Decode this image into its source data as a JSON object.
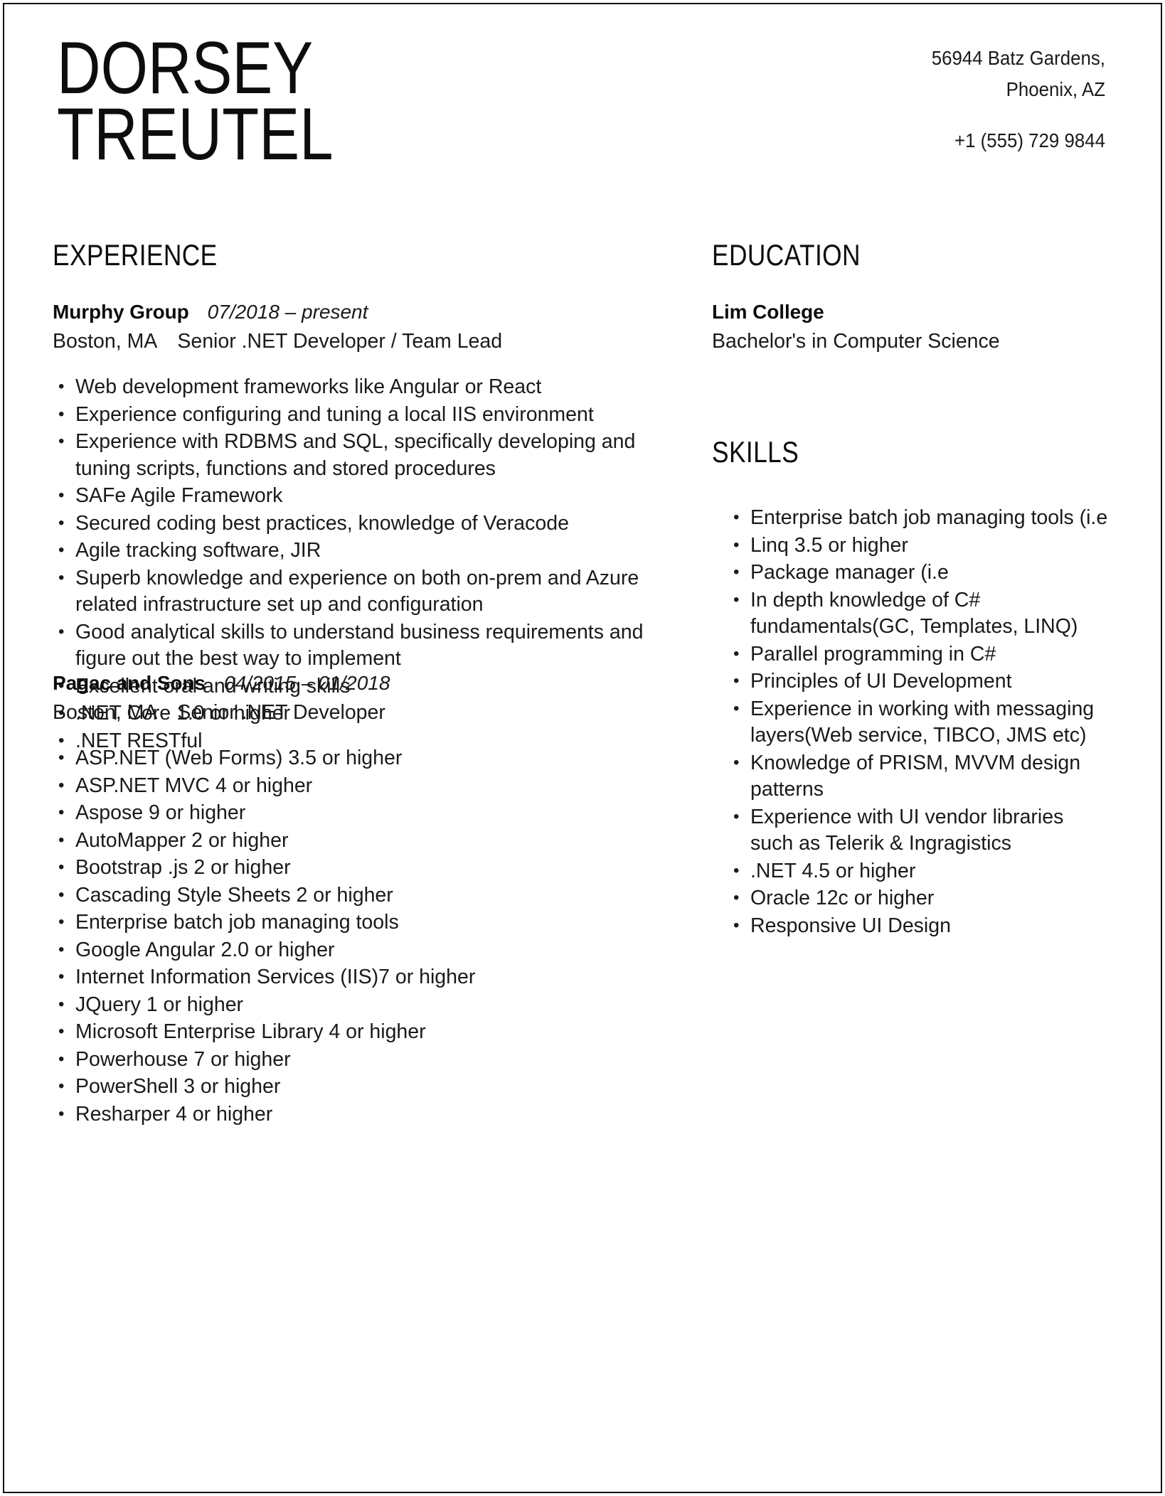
{
  "document": {
    "type": "resume"
  },
  "header": {
    "name_line_1": "DORSEY",
    "name_line_2": "TREUTEL",
    "address_line_1": "56944 Batz Gardens,",
    "address_line_2": "Phoenix, AZ",
    "phone": "+1 (555) 729 9844"
  },
  "experience": {
    "title": "EXPERIENCE",
    "entries": [
      {
        "organization": "Murphy Group",
        "dates": "07/2018 – present",
        "location": "Boston, MA",
        "role": "Senior .NET Developer / Team Lead",
        "bullets": [
          "Web development frameworks like Angular or React",
          "Experience configuring and tuning a local IIS environment",
          "Experience with RDBMS and SQL, specifically developing and tuning scripts, functions and stored procedures",
          "SAFe Agile Framework",
          "Secured coding best practices, knowledge of Veracode",
          "Agile tracking software, JIR",
          "Superb knowledge and experience on both on-prem and Azure related infrastructure set up and configuration",
          "Good analytical skills to understand business requirements and figure out the best way to implement",
          "Excellent oral and writing skills",
          ".NET Core 1.0 or higher",
          ".NET RESTful"
        ]
      },
      {
        "organization": "Pagac and Sons",
        "dates": "04/2015 – 01/2018",
        "location": "Boston, MA",
        "role": "Senior .NET Developer",
        "bullets": [
          "ASP.NET (Web Forms) 3.5 or higher",
          "ASP.NET MVC 4 or higher",
          "Aspose 9 or higher",
          "AutoMapper 2 or higher",
          "Bootstrap .js 2 or higher",
          "Cascading Style Sheets 2 or higher",
          "Enterprise batch job managing tools",
          "Google Angular 2.0 or higher",
          "Internet Information Services (IIS)7 or higher",
          "JQuery 1 or higher",
          "Microsoft Enterprise Library 4 or higher",
          "Powerhouse 7 or higher",
          "PowerShell 3 or higher",
          "Resharper 4 or higher"
        ]
      }
    ]
  },
  "education": {
    "title": "EDUCATION",
    "entries": [
      {
        "school": "Lim College",
        "degree": "Bachelor's in Computer Science"
      }
    ]
  },
  "skills": {
    "title": "SKILLS",
    "items": [
      "Enterprise batch job managing tools (i.e",
      "Linq 3.5 or higher",
      "Package manager (i.e",
      "In depth knowledge of C# fundamentals(GC, Templates, LINQ)",
      "Parallel programming in C#",
      "Principles of UI Development",
      "Experience in working with messaging layers(Web service, TIBCO, JMS etc)",
      "Knowledge of PRISM, MVVM design patterns",
      "Experience with UI vendor libraries such as Telerik & Ingragistics",
      ".NET 4.5 or higher",
      "Oracle 12c or higher",
      "Responsive UI Design"
    ]
  },
  "theme": {
    "text_color": "#1a1a1a",
    "heading_color": "#0d0d0d",
    "background": "#ffffff",
    "border_color": "#111111"
  }
}
